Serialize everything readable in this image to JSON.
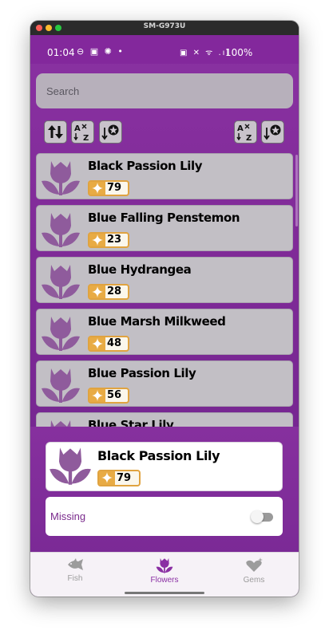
{
  "window": {
    "title": "SM-G973U"
  },
  "status_bar": {
    "time": "01:04",
    "left_icons": "⊖ ▣ ✺ •",
    "right_icons": "▣ ✕ ᯤ .ıl",
    "battery": "100%"
  },
  "search": {
    "placeholder": "Search"
  },
  "toolbar": {
    "left": [
      "sort-direction-icon",
      "sort-alpha-icon",
      "sort-rarity-icon"
    ],
    "right": [
      "sort-alpha-icon",
      "sort-rarity-icon"
    ]
  },
  "flowers": [
    {
      "name": "Black Passion Lily",
      "value": "79"
    },
    {
      "name": "Blue Falling Penstemon",
      "value": "23"
    },
    {
      "name": "Blue Hydrangea",
      "value": "28"
    },
    {
      "name": "Blue Marsh Milkweed",
      "value": "48"
    },
    {
      "name": "Blue Passion Lily",
      "value": "56"
    },
    {
      "name": "Blue Star Lily",
      "value": ""
    }
  ],
  "selected": {
    "name": "Black Passion Lily",
    "value": "79"
  },
  "missing": {
    "label": "Missing",
    "toggle_on": false
  },
  "bottom_nav": {
    "items": [
      {
        "label": "Fish",
        "icon": "fish-icon",
        "active": false
      },
      {
        "label": "Flowers",
        "icon": "flower-icon",
        "active": true
      },
      {
        "label": "Gems",
        "icon": "gem-icon",
        "active": false
      }
    ]
  },
  "colors": {
    "accent": "#8a2fa3",
    "flower_icon": "#8f5b9c",
    "badge": "#e0a340"
  }
}
